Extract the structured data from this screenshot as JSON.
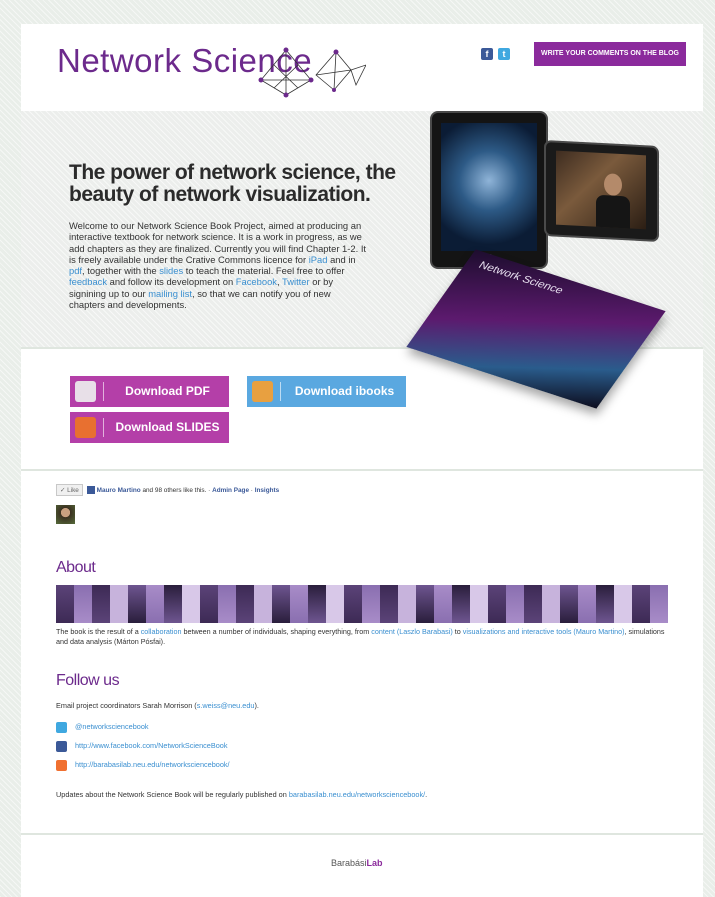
{
  "header": {
    "logo_text": "Network Science",
    "blog_button": "WRITE YOUR COMMENTS ON THE BLOG",
    "facebook_icon": "facebook-icon",
    "twitter_icon": "twitter-icon",
    "accent_color": "#8b2a9c"
  },
  "hero": {
    "title": "The power of network science, the beauty of network visualization.",
    "intro_1": "Welcome to our Network Science Book Project, aimed at producing an interactive textbook for network science. It is a work in progress, as we add chapters as they are finalized. Currently you will find Chapter 1-2. It is freely available under the Crative Commons licence for ",
    "link_ipad": "iPad",
    "intro_2": " and in ",
    "link_pdf": "pdf",
    "intro_3": ", together with the ",
    "link_slides": "slides",
    "intro_4": " to teach the material. Feel free to offer ",
    "link_feedback": "feedback",
    "intro_5": " and follow its development on ",
    "link_facebook": "Facebook",
    "intro_6": ", ",
    "link_twitter": "Twitter",
    "intro_7": " or by signining up to our ",
    "link_mailing": "mailing list",
    "intro_8": ", so that we can notify you of new chapters and developments.",
    "book_cover_title": "Network Science"
  },
  "downloads": {
    "pdf": "Download PDF",
    "ibooks": "Download ibooks",
    "slides": "Download SLIDES"
  },
  "social": {
    "like_label": "✓ Like",
    "liker_name": "Mauro Martino",
    "like_text": " and 98 others like this. · ",
    "admin_page": "Admin Page",
    "sep": " · ",
    "insights": "Insights"
  },
  "about": {
    "heading": "About",
    "p1": "The book is the result of a ",
    "link_collab": "collaboration",
    "p2": " between a number of individuals, shaping everything, from ",
    "link_content": "content (Laszlo Barabasi)",
    "p3": " to ",
    "link_vis": "visualizations and interactive tools (Mauro Martino)",
    "p4": ", simulations and data analysis (Márton Pósfai)."
  },
  "follow": {
    "heading": "Follow us",
    "email_text": "Email project coordinators Sarah Morrison (",
    "email_link": "s.weiss@neu.edu",
    "email_close": ").",
    "twitter": "@networksciencebook",
    "facebook": "http://www.facebook.com/NetworkScienceBook",
    "blog": "http://barabasilab.neu.edu/networksciencebook/",
    "updates_text": "Updates about the Network Science Book will be regularly published on ",
    "updates_link": "barabasilab.neu.edu/networksciencebook/",
    "updates_end": "."
  },
  "footer": {
    "logo_part1": "Barabási",
    "logo_part2": "Lab"
  }
}
